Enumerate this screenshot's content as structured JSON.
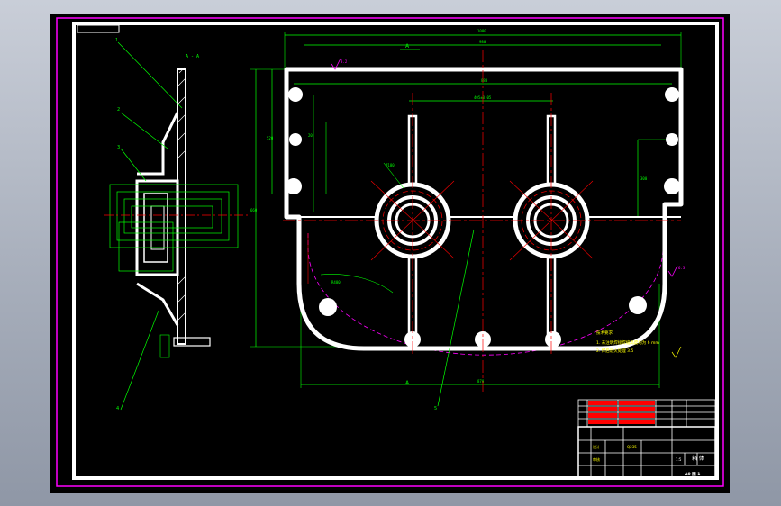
{
  "drawing": {
    "section_label": "A - A",
    "section_marker_top": "A",
    "section_marker_bottom": "A",
    "leader_numbers": [
      "1",
      "2",
      "3",
      "4",
      "5"
    ],
    "dim_overall_width": "1080",
    "dim_inner_width": "980",
    "dim_flange_width": "880",
    "dim_center_distance": "405±0.05",
    "dim_base_width": "870",
    "dim_height": "660",
    "dim_left_rise": "520",
    "dim_right_rise": "300",
    "dim_radius": "R480",
    "dim_thickness": "20",
    "dim_bore": "Ø180",
    "roughness_mark": "3.2",
    "roughness_right": "6.3",
    "notes_heading": "技术要求",
    "note_1": "1. 未注明焊接焊缝高度均为 6 mm",
    "note_2": "2. 焊后退火处理 3.5"
  },
  "title_block": {
    "drawing_title": "箱 体",
    "scale": "1:5",
    "sheet": "A0 图 1",
    "material": "Q235",
    "designer": "设计",
    "checker": "审核"
  },
  "colors": {
    "frame": "#ff00ff",
    "outline": "#ffffff",
    "dimension": "#00ff00",
    "centerline": "#ff0000",
    "hidden": "#ff00ff",
    "annotation": "#ffff00"
  }
}
